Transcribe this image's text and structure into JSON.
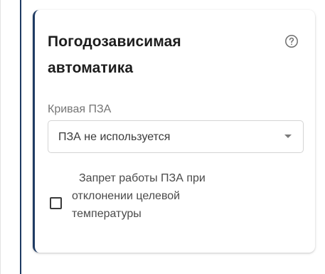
{
  "card": {
    "title_line1": "Погодозависимая",
    "title_line2": "автоматика",
    "help_icon": "question-circle-icon",
    "accent_color": "#1f3b63"
  },
  "curve_field": {
    "label": "Кривая ПЗА",
    "selected_value": "ПЗА не используется",
    "dropdown_icon": "caret-down-icon"
  },
  "deviation_checkbox": {
    "checked": false,
    "label_line1": "Запрет работы ПЗА при",
    "label_line2": "отклонении целевой",
    "label_line3": "температуры"
  }
}
